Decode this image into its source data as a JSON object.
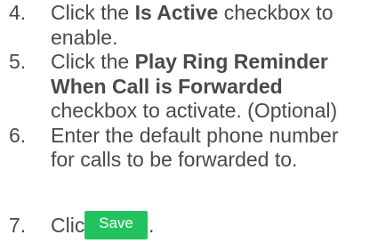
{
  "steps": [
    {
      "number": "4.",
      "line1_pre": "Click the ",
      "line1_bold": "Is Active",
      "line1_post": " checkbox to",
      "line2": "enable."
    },
    {
      "number": "5.",
      "line1_pre": "Click the ",
      "line1_bold": "Play Ring Reminder",
      "line2_bold": "When Call is Forwarded",
      "line3": "checkbox to activate. (Optional)"
    },
    {
      "number": "6.",
      "line1": "Enter the default phone number",
      "line2": "for calls to be forwarded to."
    },
    {
      "number": "7.",
      "text": "Click",
      "button_label": "Save",
      "period": "."
    }
  ],
  "colors": {
    "text": "#4a4a4a",
    "save_button": "#22c35e",
    "save_button_text": "#ffffff"
  }
}
